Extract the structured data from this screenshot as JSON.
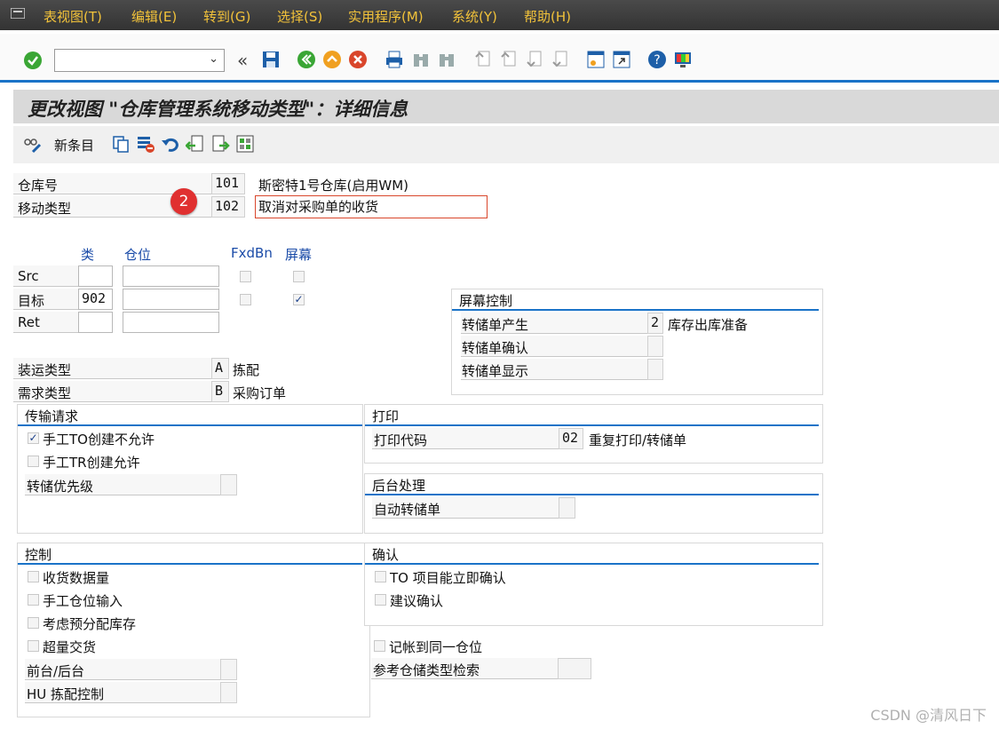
{
  "menu": [
    "表视图(T)",
    "编辑(E)",
    "转到(G)",
    "选择(S)",
    "实用程序(M)",
    "系统(Y)",
    "帮助(H)"
  ],
  "title": "更改视图 \"仓库管理系统移动类型\"：详细信息",
  "app_toolbar": {
    "new_entries_label": "新条目"
  },
  "header": {
    "warehouse_label": "仓库号",
    "warehouse_value": "101",
    "warehouse_desc": "斯密特1号仓库(启用WM)",
    "movtype_label": "移动类型",
    "movtype_value": "102",
    "movtype_desc": "取消对采购单的收货",
    "badge": "2"
  },
  "grid": {
    "col_type": "类",
    "col_bin": "仓位",
    "col_fxdbn": "FxdBn",
    "col_screen": "屏幕",
    "rows": [
      {
        "label": "Src",
        "type": "",
        "bin": "",
        "fxdbn": false,
        "screen": false
      },
      {
        "label": "目标",
        "type": "902",
        "bin": "",
        "fxdbn": false,
        "screen": true
      },
      {
        "label": "Ret",
        "type": "",
        "bin": ""
      }
    ]
  },
  "shipping": {
    "label": "装运类型",
    "value": "A",
    "desc": "拣配"
  },
  "requirement": {
    "label": "需求类型",
    "value": "B",
    "desc": "采购订单"
  },
  "screen_control": {
    "title": "屏幕控制",
    "to_create_label": "转储单产生",
    "to_create_value": "2",
    "to_create_desc": "库存出库准备",
    "to_confirm_label": "转储单确认",
    "to_display_label": "转储单显示"
  },
  "transfer_request": {
    "title": "传输请求",
    "manual_to_label": "手工TO创建不允许",
    "manual_to_checked": true,
    "manual_tr_label": "手工TR创建允许",
    "manual_tr_checked": false,
    "priority_label": "转储优先级"
  },
  "print": {
    "title": "打印",
    "code_label": "打印代码",
    "code_value": "02",
    "code_desc": "重复打印/转储单"
  },
  "background": {
    "title": "后台处理",
    "auto_to_label": "自动转储单"
  },
  "control": {
    "title": "控制",
    "items": [
      "收货数据量",
      "手工仓位输入",
      "考虑预分配库存",
      "超量交货"
    ],
    "fg_bg_label": "前台/后台",
    "hu_label": "HU 拣配控制"
  },
  "confirm": {
    "title": "确认",
    "to_immediate_label": "TO 项目能立即确认",
    "suggest_label": "建议确认"
  },
  "post_same_bin_label": "记帐到同一仓位",
  "ref_storage_label": "参考仓储类型检索",
  "watermark": "CSDN @清风日下"
}
